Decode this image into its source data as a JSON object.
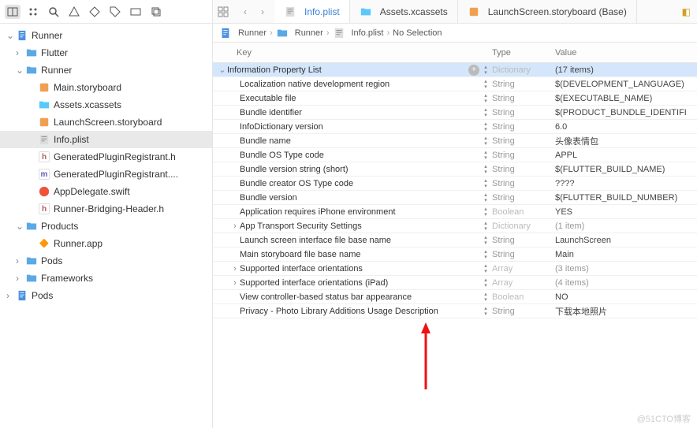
{
  "toolbar_icons": [
    "square.split",
    "grid",
    "search",
    "warning",
    "diamond",
    "tag",
    "panel",
    "layers"
  ],
  "sidebar": [
    {
      "d": 0,
      "disc": "v",
      "icon": "proj",
      "label": "Runner"
    },
    {
      "d": 1,
      "disc": ">",
      "icon": "folder",
      "label": "Flutter"
    },
    {
      "d": 1,
      "disc": "v",
      "icon": "folder",
      "label": "Runner"
    },
    {
      "d": 2,
      "disc": "",
      "icon": "story",
      "label": "Main.storyboard"
    },
    {
      "d": 2,
      "disc": "",
      "icon": "xcassets",
      "label": "Assets.xcassets"
    },
    {
      "d": 2,
      "disc": "",
      "icon": "story",
      "label": "LaunchScreen.storyboard"
    },
    {
      "d": 2,
      "disc": "",
      "icon": "plist",
      "label": "Info.plist",
      "sel": true
    },
    {
      "d": 2,
      "disc": "",
      "icon": "h",
      "label": "GeneratedPluginRegistrant.h"
    },
    {
      "d": 2,
      "disc": "",
      "icon": "m",
      "label": "GeneratedPluginRegistrant...."
    },
    {
      "d": 2,
      "disc": "",
      "icon": "swift",
      "label": "AppDelegate.swift"
    },
    {
      "d": 2,
      "disc": "",
      "icon": "h",
      "label": "Runner-Bridging-Header.h"
    },
    {
      "d": 1,
      "disc": "v",
      "icon": "folder",
      "label": "Products"
    },
    {
      "d": 2,
      "disc": "",
      "icon": "app",
      "label": "Runner.app"
    },
    {
      "d": 1,
      "disc": ">",
      "icon": "folder",
      "label": "Pods"
    },
    {
      "d": 1,
      "disc": ">",
      "icon": "folder",
      "label": "Frameworks"
    },
    {
      "d": 0,
      "disc": ">",
      "icon": "proj",
      "label": "Pods"
    }
  ],
  "tabs": [
    {
      "icon": "plist",
      "label": "Info.plist",
      "active": true
    },
    {
      "icon": "xcassets",
      "label": "Assets.xcassets"
    },
    {
      "icon": "story",
      "label": "LaunchScreen.storyboard (Base)"
    }
  ],
  "breadcrumb": [
    {
      "icon": "proj",
      "label": "Runner"
    },
    {
      "icon": "folder",
      "label": "Runner"
    },
    {
      "icon": "plist",
      "label": "Info.plist"
    },
    {
      "icon": "",
      "label": "No Selection"
    }
  ],
  "headers": {
    "key": "Key",
    "type": "Type",
    "value": "Value"
  },
  "plist": [
    {
      "d": 0,
      "disc": "v",
      "key": "Information Property List",
      "type": "Dictionary",
      "value": "(17 items)",
      "sel": true,
      "plus": true
    },
    {
      "d": 1,
      "disc": "",
      "key": "Localization native development region",
      "type": "String",
      "value": "$(DEVELOPMENT_LANGUAGE)"
    },
    {
      "d": 1,
      "disc": "",
      "key": "Executable file",
      "type": "String",
      "value": "$(EXECUTABLE_NAME)"
    },
    {
      "d": 1,
      "disc": "",
      "key": "Bundle identifier",
      "type": "String",
      "value": "$(PRODUCT_BUNDLE_IDENTIFI"
    },
    {
      "d": 1,
      "disc": "",
      "key": "InfoDictionary version",
      "type": "String",
      "value": "6.0"
    },
    {
      "d": 1,
      "disc": "",
      "key": "Bundle name",
      "type": "String",
      "value": "头像表情包"
    },
    {
      "d": 1,
      "disc": "",
      "key": "Bundle OS Type code",
      "type": "String",
      "value": "APPL"
    },
    {
      "d": 1,
      "disc": "",
      "key": "Bundle version string (short)",
      "type": "String",
      "value": "$(FLUTTER_BUILD_NAME)"
    },
    {
      "d": 1,
      "disc": "",
      "key": "Bundle creator OS Type code",
      "type": "String",
      "value": "????"
    },
    {
      "d": 1,
      "disc": "",
      "key": "Bundle version",
      "type": "String",
      "value": "$(FLUTTER_BUILD_NUMBER)"
    },
    {
      "d": 1,
      "disc": "",
      "key": "Application requires iPhone environment",
      "type": "Boolean",
      "value": "YES"
    },
    {
      "d": 1,
      "disc": ">",
      "key": "App Transport Security Settings",
      "type": "Dictionary",
      "value": "(1 item)",
      "faint": true
    },
    {
      "d": 1,
      "disc": "",
      "key": "Launch screen interface file base name",
      "type": "String",
      "value": "LaunchScreen"
    },
    {
      "d": 1,
      "disc": "",
      "key": "Main storyboard file base name",
      "type": "String",
      "value": "Main"
    },
    {
      "d": 1,
      "disc": ">",
      "key": "Supported interface orientations",
      "type": "Array",
      "value": "(3 items)",
      "faint": true
    },
    {
      "d": 1,
      "disc": ">",
      "key": "Supported interface orientations (iPad)",
      "type": "Array",
      "value": "(4 items)",
      "faint": true
    },
    {
      "d": 1,
      "disc": "",
      "key": "View controller-based status bar appearance",
      "type": "Boolean",
      "value": "NO"
    },
    {
      "d": 1,
      "disc": "",
      "key": "Privacy - Photo Library Additions Usage Description",
      "type": "String",
      "value": "下载本地照片"
    }
  ],
  "watermark": "@51CTO博客"
}
